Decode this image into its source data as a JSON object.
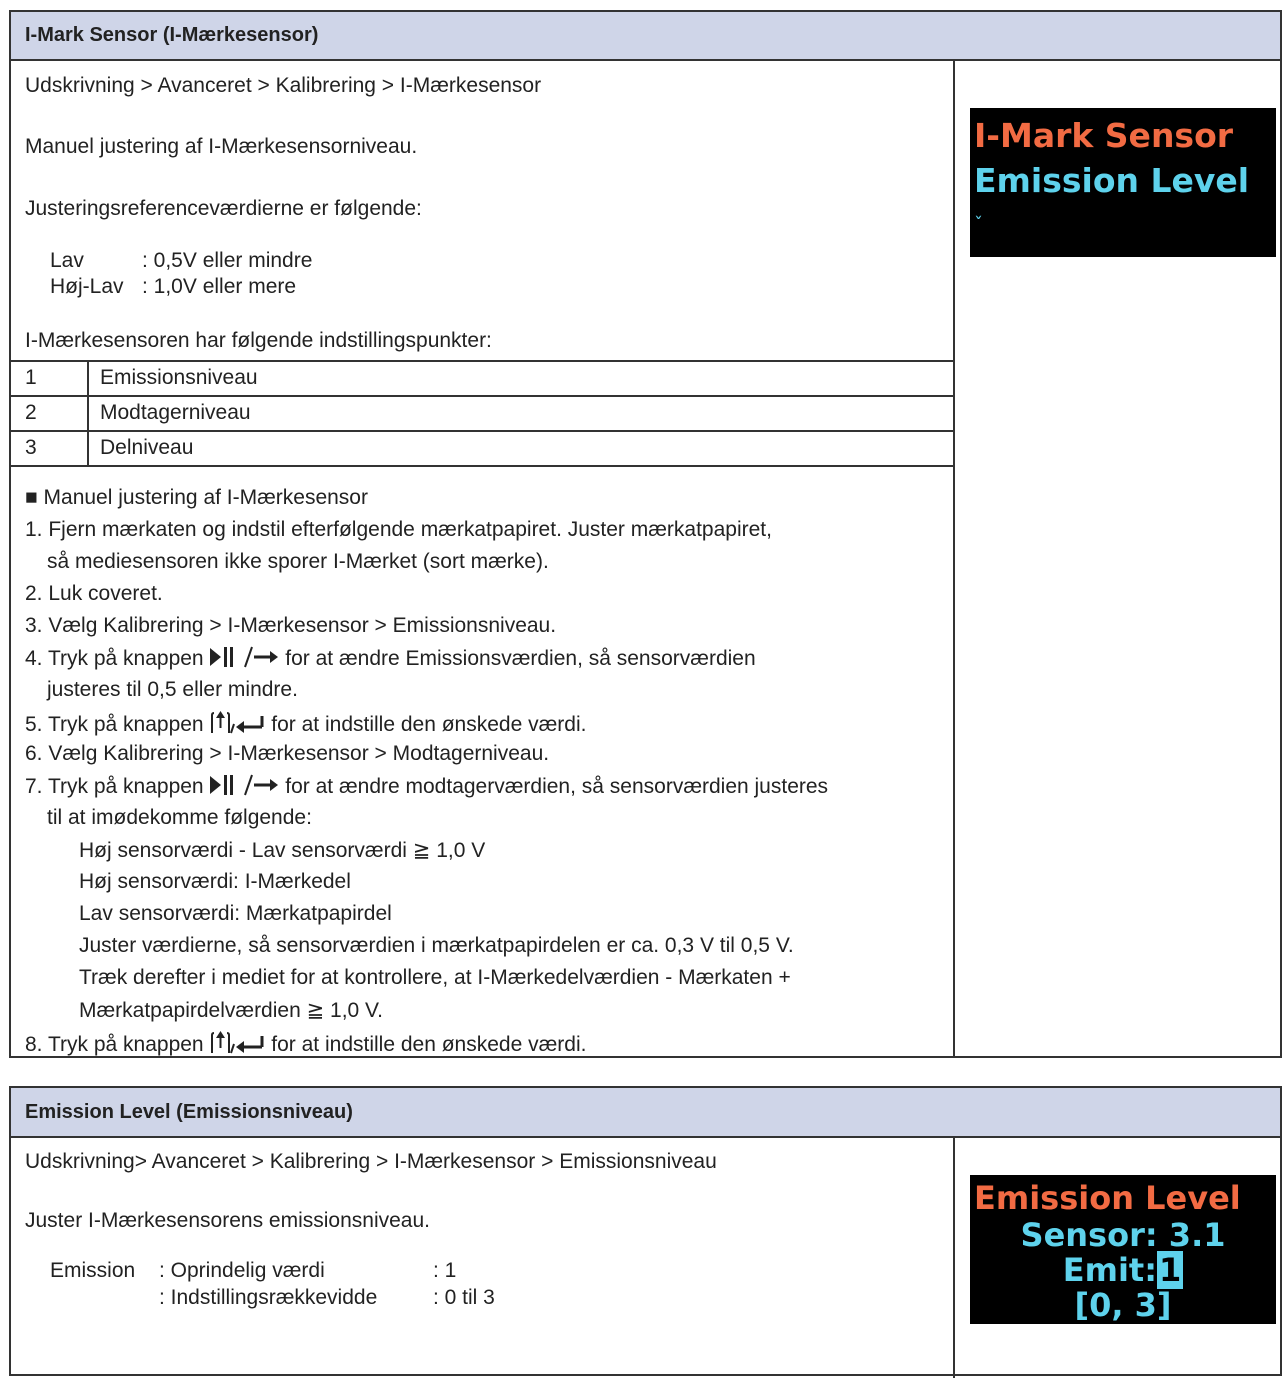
{
  "section1": {
    "header": "I-Mark Sensor (I-Mærkesensor)",
    "path": "Udskrivning > Avanceret > Kalibrering > I-Mærkesensor",
    "description": "Manuel justering af I-Mærkesensorniveau.",
    "ref_intro": "Justeringsreferenceværdierne er følgende:",
    "ref_rows": [
      {
        "label": "Lav",
        "value": ": 0,5V eller mindre"
      },
      {
        "label": "Høj-Lav",
        "value": ": 1,0V eller mere"
      }
    ],
    "points_intro": "I-Mærkesensoren har følgende indstillingspunkter:",
    "points": [
      {
        "num": "1",
        "label": "Emissionsniveau"
      },
      {
        "num": "2",
        "label": "Modtagerniveau"
      },
      {
        "num": "3",
        "label": "Delniveau"
      }
    ],
    "proc_title": "■ Manuel justering af I-Mærkesensor",
    "steps": {
      "s1a": "1. Fjern mærkaten og indstil efterfølgende mærkatpapiret. Juster mærkatpapiret,",
      "s1b": "så mediesensoren ikke sporer I-Mærket (sort mærke).",
      "s2": "2. Luk coveret.",
      "s3": "3. Vælg Kalibrering > I-Mærkesensor > Emissionsniveau.",
      "s4_pre": "4. Tryk på knappen ",
      "s4_post": " for at ændre Emissionsværdien, så sensorværdien",
      "s4b": "justeres til 0,5 eller mindre.",
      "s5_pre": "5. Tryk på knappen ",
      "s5_post": " for at indstille den ønskede værdi.",
      "s6": "6. Vælg Kalibrering > I-Mærkesensor > Modtagerniveau.",
      "s7_pre": "7. Tryk på knappen ",
      "s7_post": " for at ændre modtagerværdien, så sensorværdien justeres",
      "s7b": "til at imødekomme følgende:",
      "s7c": "Høj sensorværdi - Lav sensorværdi ≧ 1,0 V",
      "s7d": "Høj sensorværdi: I-Mærkedel",
      "s7e": "Lav sensorværdi: Mærkatpapirdel",
      "s7f": "Juster værdierne, så sensorværdien i mærkatpapirdelen er ca. 0,3 V til 0,5 V.",
      "s7g": "Træk derefter i mediet for at kontrollere, at I-Mærkedelværdien - Mærkaten +",
      "s7h": "Mærkatpapirdelværdien ≧ 1,0 V.",
      "s8_pre": "8. Tryk på knappen ",
      "s8_post": " for at indstille den ønskede værdi."
    },
    "lcd": {
      "line1": "I-Mark Sensor",
      "line2": "Emission Level",
      "line3": "ˇ"
    }
  },
  "section2": {
    "header": "Emission Level (Emissionsniveau)",
    "path": "Udskrivning> Avanceret > Kalibrering > I-Mærkesensor > Emissionsniveau",
    "description": "Juster I-Mærkesensorens emissionsniveau.",
    "param_label": "Emission",
    "row1_key": ": Oprindelig værdi",
    "row1_val": ":  1",
    "row2_key": ": Indstillingsrækkevidde",
    "row2_val": ":  0 til 3",
    "lcd": {
      "line1": "Emission Level",
      "line2": "Sensor: 3.1",
      "line3_label": "Emit:",
      "line3_value": "1",
      "line4": "[0, 3]"
    }
  },
  "icons": [
    "play-pause-icon",
    "arrow-right-icon",
    "feed-icon",
    "enter-icon"
  ]
}
